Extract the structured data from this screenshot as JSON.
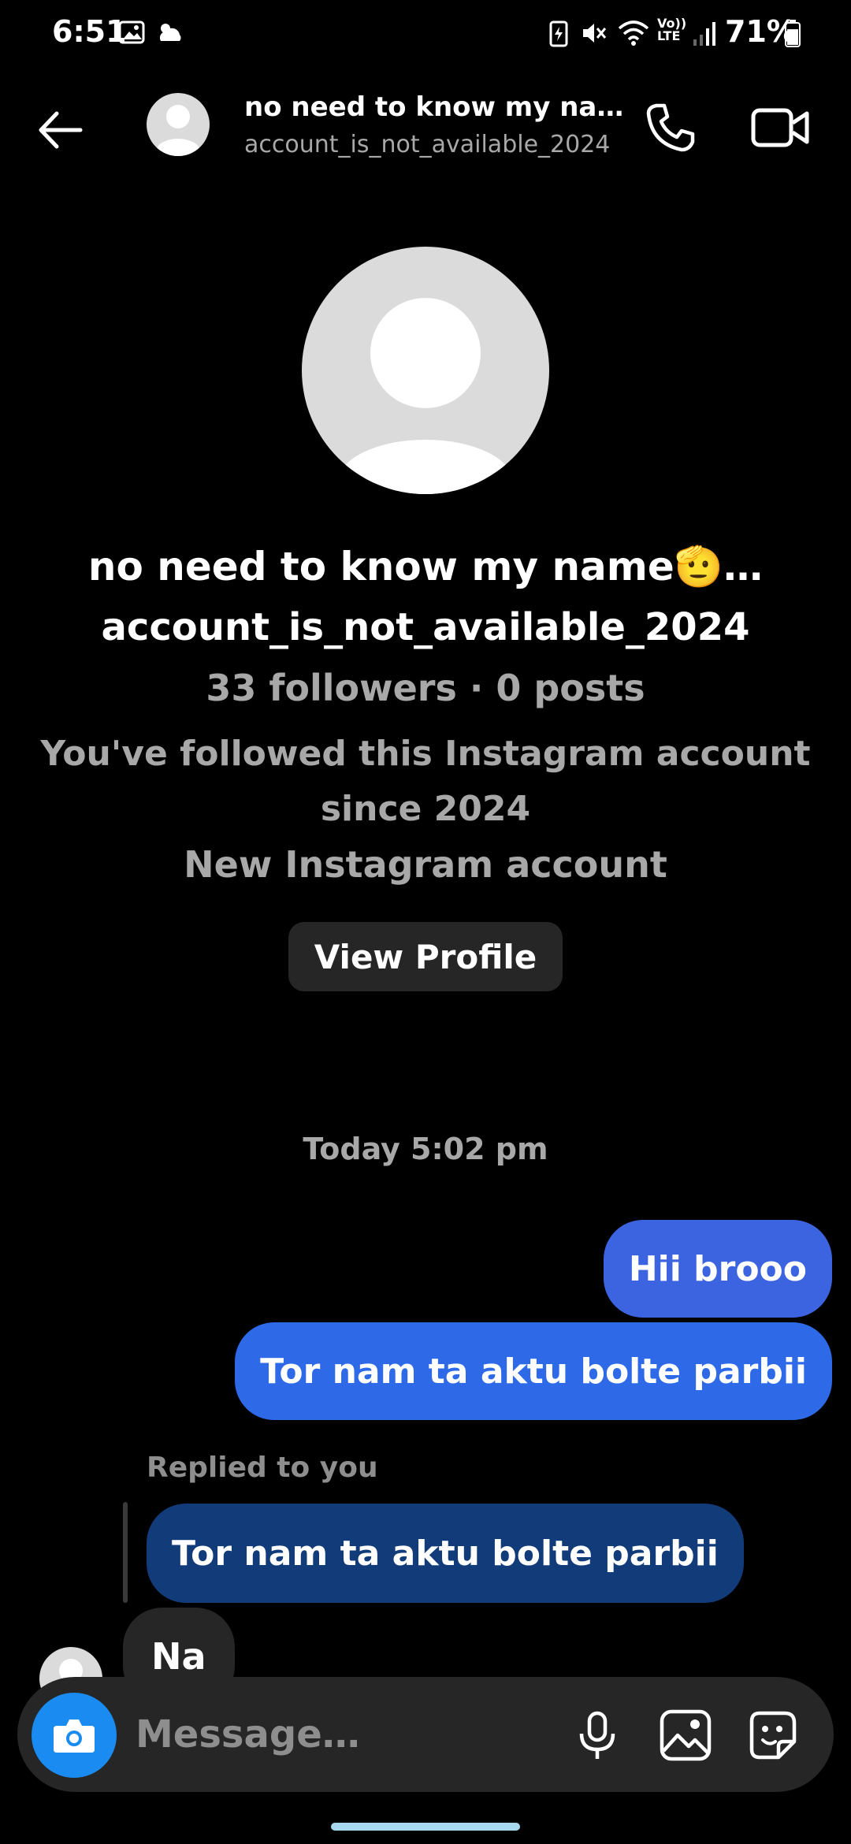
{
  "status_bar": {
    "time": "6:51",
    "battery_percent": "71%",
    "battery_level": 0.71,
    "icons": [
      "gallery-icon",
      "weather-icon",
      "battery-saver-icon",
      "mute-icon",
      "wifi-icon",
      "volte-icon",
      "signal-icon",
      "battery-icon"
    ],
    "volte_label": "Vo)) LTE"
  },
  "header": {
    "name": "no need to know my na…",
    "username": "account_is_not_available_2024"
  },
  "profile": {
    "name": "no need to know my name🫡…",
    "username": "account_is_not_available_2024",
    "stats": "33 followers · 0 posts",
    "follow_note": "You've followed this Instagram account since 2024",
    "new_account": "New Instagram account",
    "view_profile_label": "View Profile"
  },
  "conversation": {
    "timestamp": "Today 5:02 pm",
    "outgoing": [
      {
        "text": "Hii brooo"
      },
      {
        "text": "Tor nam ta aktu bolte parbii"
      }
    ],
    "reply_label": "Replied to you",
    "reply_quote": "Tor nam ta aktu bolte parbii",
    "incoming": [
      {
        "text": "Na"
      }
    ]
  },
  "composer": {
    "placeholder": "Message…"
  },
  "colors": {
    "background": "#000000",
    "outgoing_bubble": "#3d64e0",
    "reply_bubble": "#123b7a",
    "incoming_bubble": "#262626",
    "camera_button": "#1a8bf0",
    "muted_text": "#a8a8a8"
  }
}
